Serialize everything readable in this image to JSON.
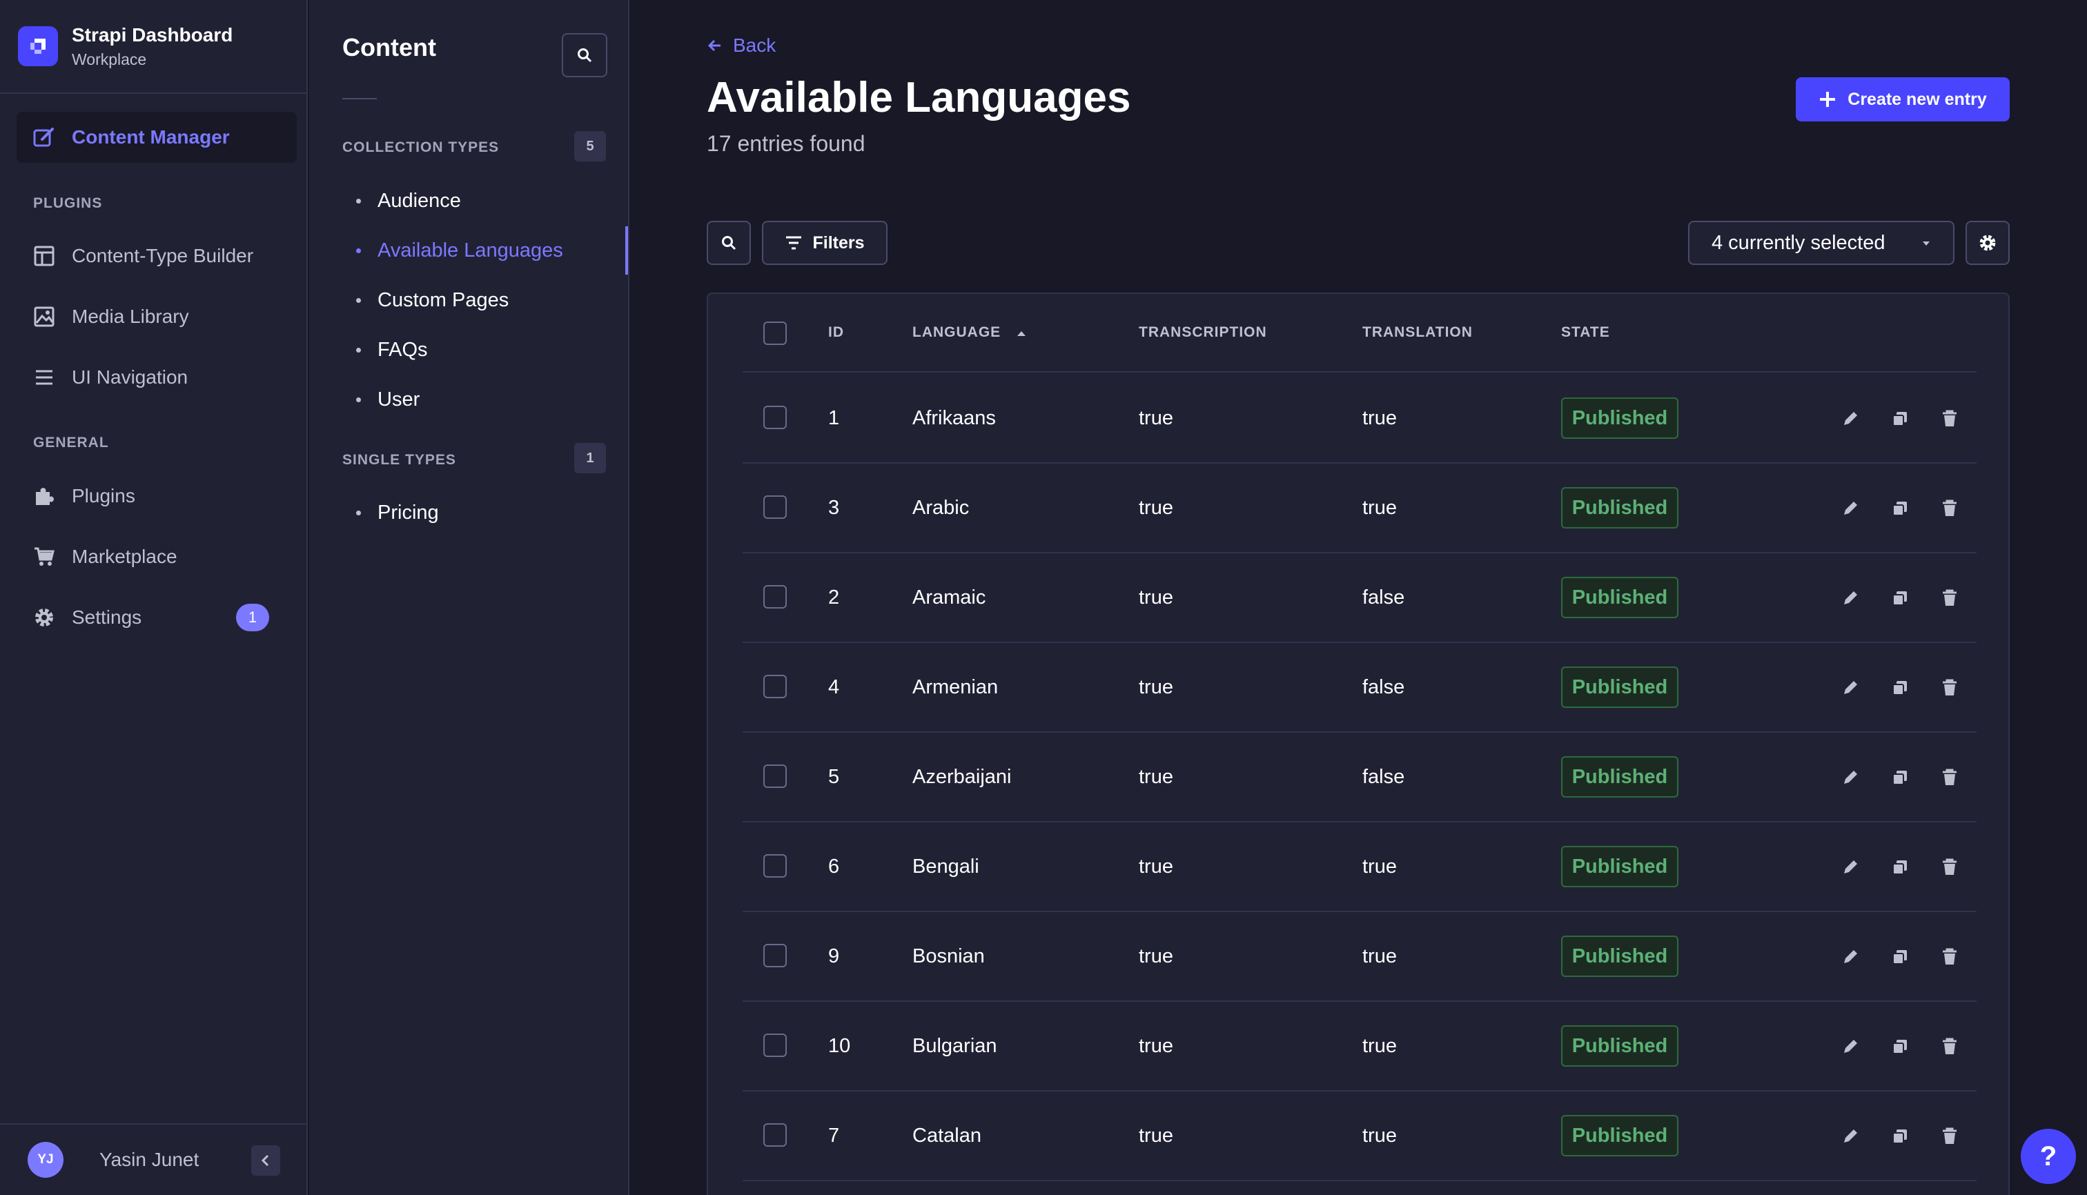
{
  "brand": {
    "title": "Strapi Dashboard",
    "subtitle": "Workplace"
  },
  "main_nav": {
    "content_manager": "Content Manager",
    "plugins_section": "PLUGINS",
    "content_type_builder": "Content-Type Builder",
    "media_library": "Media Library",
    "ui_navigation": "UI Navigation",
    "general_section": "GENERAL",
    "plugins": "Plugins",
    "marketplace": "Marketplace",
    "settings": "Settings",
    "settings_badge": "1"
  },
  "user": {
    "initials": "YJ",
    "name": "Yasin Junet"
  },
  "sub_nav": {
    "title": "Content",
    "collection_types_label": "COLLECTION TYPES",
    "collection_types_count": "5",
    "collection_types": [
      "Audience",
      "Available Languages",
      "Custom Pages",
      "FAQs",
      "User"
    ],
    "single_types_label": "SINGLE TYPES",
    "single_types_count": "1",
    "single_types": [
      "Pricing"
    ]
  },
  "header": {
    "back": "Back",
    "title": "Available Languages",
    "entries": "17 entries found",
    "create_button": "Create new entry"
  },
  "toolbar": {
    "filters": "Filters",
    "columns_selected": "4 currently selected"
  },
  "table": {
    "headers": {
      "id": "ID",
      "language": "LANGUAGE",
      "transcription": "TRANSCRIPTION",
      "translation": "TRANSLATION",
      "state": "STATE"
    },
    "rows": [
      {
        "id": "1",
        "language": "Afrikaans",
        "transcription": "true",
        "translation": "true",
        "state": "Published"
      },
      {
        "id": "3",
        "language": "Arabic",
        "transcription": "true",
        "translation": "true",
        "state": "Published"
      },
      {
        "id": "2",
        "language": "Aramaic",
        "transcription": "true",
        "translation": "false",
        "state": "Published"
      },
      {
        "id": "4",
        "language": "Armenian",
        "transcription": "true",
        "translation": "false",
        "state": "Published"
      },
      {
        "id": "5",
        "language": "Azerbaijani",
        "transcription": "true",
        "translation": "false",
        "state": "Published"
      },
      {
        "id": "6",
        "language": "Bengali",
        "transcription": "true",
        "translation": "true",
        "state": "Published"
      },
      {
        "id": "9",
        "language": "Bosnian",
        "transcription": "true",
        "translation": "true",
        "state": "Published"
      },
      {
        "id": "10",
        "language": "Bulgarian",
        "transcription": "true",
        "translation": "true",
        "state": "Published"
      },
      {
        "id": "7",
        "language": "Catalan",
        "transcription": "true",
        "translation": "true",
        "state": "Published"
      }
    ]
  },
  "help": "?",
  "colors": {
    "accent": "#7b79ff",
    "primary": "#4945ff",
    "published": "#5cb176",
    "background": "#181826",
    "panel": "#212134"
  }
}
